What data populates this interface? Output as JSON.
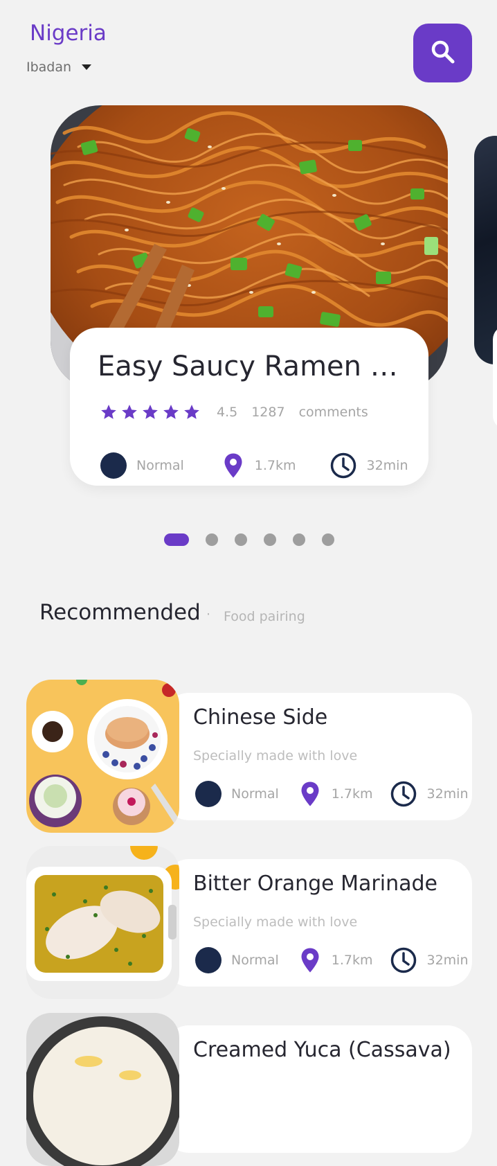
{
  "header": {
    "country": "Nigeria",
    "city": "Ibadan"
  },
  "featured": {
    "title": "Easy Saucy Ramen No...",
    "rating": "4.5",
    "comment_count": "1287",
    "comments_label": "comments",
    "difficulty": "Normal",
    "distance": "1.7km",
    "time": "32min",
    "stars": 5
  },
  "carousel": {
    "page_count": 6,
    "active_index": 0
  },
  "section": {
    "title": "Recommended",
    "separator": "·",
    "tab": "Food pairing"
  },
  "recommended": [
    {
      "title": "Chinese Side",
      "subtitle": "Specially made with love",
      "difficulty": "Normal",
      "distance": "1.7km",
      "time": "32min"
    },
    {
      "title": "Bitter Orange Marinade",
      "subtitle": "Specially made with love",
      "difficulty": "Normal",
      "distance": "1.7km",
      "time": "32min"
    },
    {
      "title": "Creamed Yuca (Cassava)",
      "subtitle": "",
      "difficulty": "",
      "distance": "",
      "time": ""
    }
  ],
  "colors": {
    "accent": "#6a3bc7",
    "dark_dot": "#1b2a4b",
    "background": "#f2f2f2"
  },
  "icons": {
    "search": "search-icon",
    "dropdown": "caret-down-icon",
    "star": "star-icon",
    "location": "location-pin-icon",
    "clock": "clock-icon"
  }
}
